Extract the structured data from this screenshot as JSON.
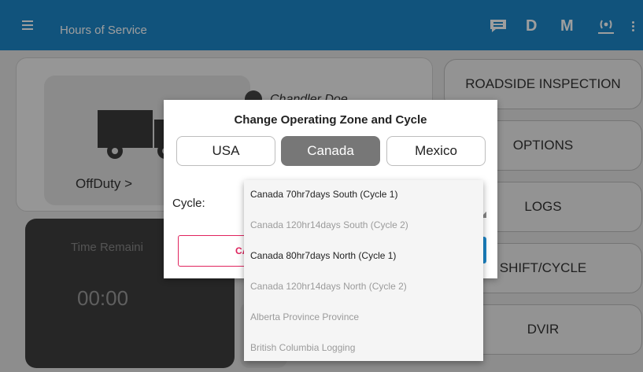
{
  "appbar": {
    "title": "Hours of Service",
    "actions": [
      {
        "name": "message-icon"
      },
      {
        "label": "D"
      },
      {
        "label": "M"
      },
      {
        "name": "radio-signal-icon"
      },
      {
        "name": "more-vert-icon"
      }
    ],
    "color": "#1c86c8"
  },
  "status": {
    "duty_status": "OffDuty",
    "duty_chevron": ">",
    "driver_name": "Chandler Doe",
    "time_remaining_label": "Time Remaini",
    "time_value": "00:00"
  },
  "right_buttons": [
    "ROADSIDE INSPECTION",
    "OPTIONS",
    "LOGS",
    "SHIFT/CYCLE",
    "DVIR"
  ],
  "dialog": {
    "title": "Change Operating Zone and Cycle",
    "zones": [
      "USA",
      "Canada",
      "Mexico"
    ],
    "selected_zone": "Canada",
    "cycle_label": "Cycle:",
    "cancel_label": "CA",
    "accent": "#e0245e"
  },
  "dropdown": {
    "items": [
      {
        "label": "Canada 70hr7days South (Cycle 1)",
        "enabled": true
      },
      {
        "label": "Canada 120hr14days South (Cycle 2)",
        "enabled": false
      },
      {
        "label": "Canada 80hr7days North (Cycle 1)",
        "enabled": true
      },
      {
        "label": "Canada 120hr14days North (Cycle 2)",
        "enabled": false
      },
      {
        "label": "Alberta Province Province",
        "enabled": false
      },
      {
        "label": "British Columbia Logging",
        "enabled": false
      }
    ]
  }
}
